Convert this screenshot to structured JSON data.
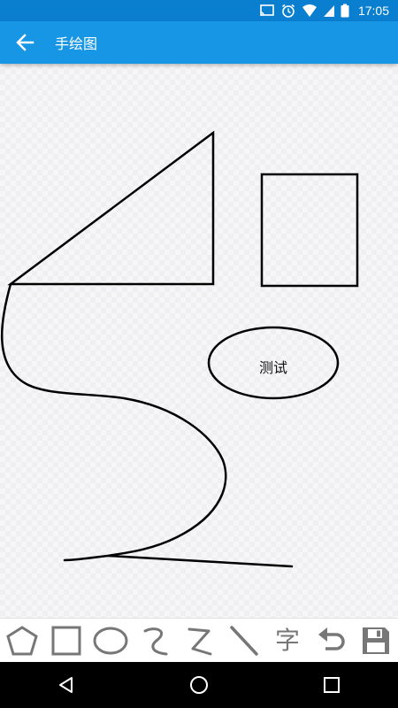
{
  "status_bar": {
    "time": "17:05",
    "icons": [
      "cast-icon",
      "alarm-icon",
      "wifi-icon",
      "signal-icon",
      "battery-icon"
    ]
  },
  "app_bar": {
    "title": "手绘图",
    "back_icon": "arrow-back-icon",
    "color": "#1896e6"
  },
  "canvas": {
    "ellipse_text": "测试"
  },
  "toolbar": {
    "tools": [
      {
        "name": "pentagon-tool",
        "icon": "pentagon-icon"
      },
      {
        "name": "rectangle-tool",
        "icon": "rectangle-icon"
      },
      {
        "name": "ellipse-tool",
        "icon": "ellipse-icon"
      },
      {
        "name": "curve-tool",
        "icon": "curve-icon"
      },
      {
        "name": "zigzag-tool",
        "icon": "zigzag-icon"
      },
      {
        "name": "line-tool",
        "icon": "line-icon"
      },
      {
        "name": "text-tool",
        "label": "字"
      },
      {
        "name": "undo-tool",
        "icon": "undo-icon"
      },
      {
        "name": "save-tool",
        "icon": "save-icon"
      }
    ]
  },
  "nav_bar": {
    "buttons": [
      "back-triangle-icon",
      "home-circle-icon",
      "recents-square-icon"
    ]
  }
}
